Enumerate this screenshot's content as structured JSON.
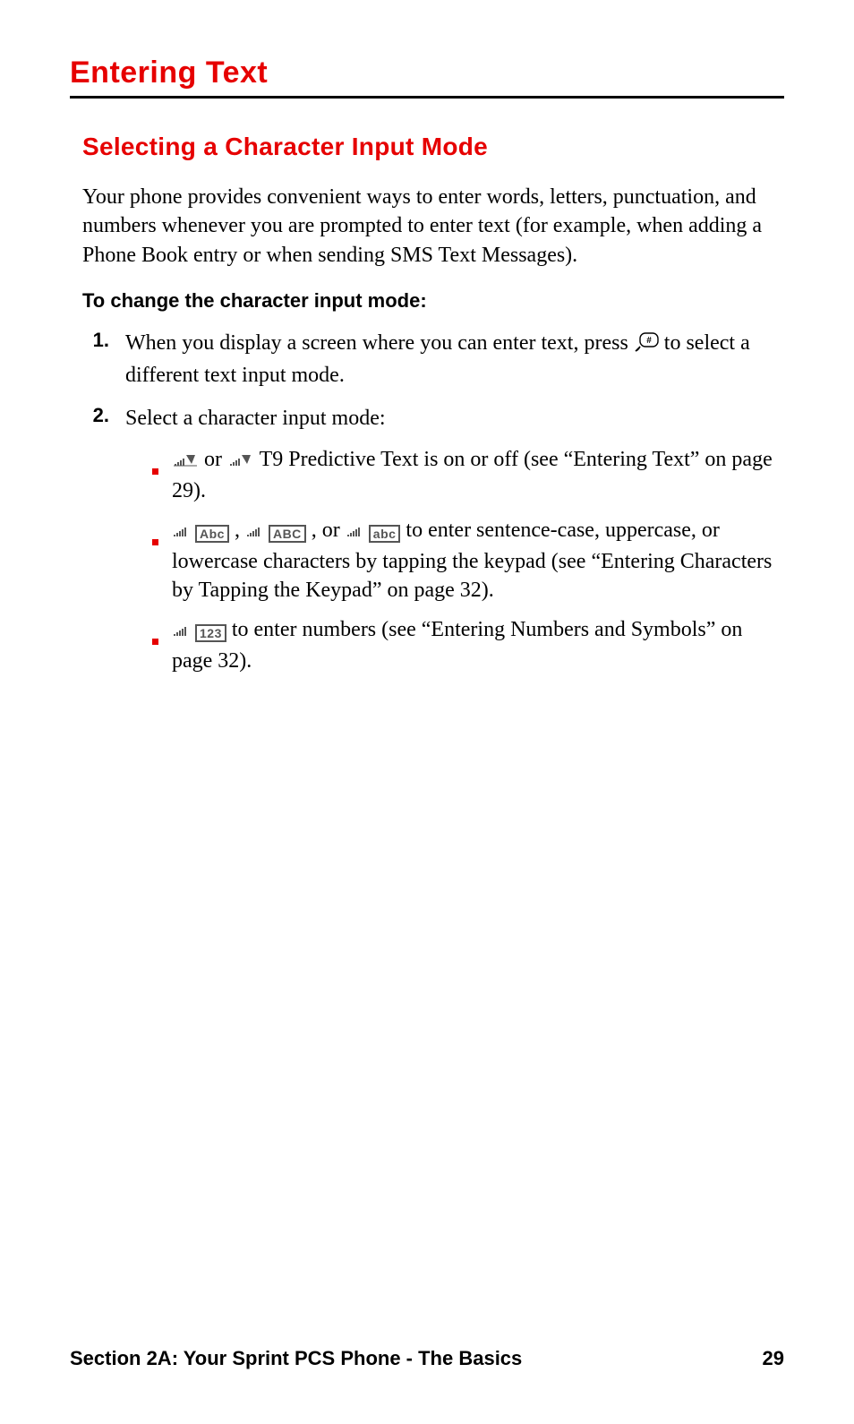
{
  "heading": "Entering Text",
  "subheading": "Selecting a Character Input Mode",
  "intro": "Your phone provides convenient ways to enter words, letters, punctuation, and numbers whenever you are prompted to enter text (for example, when adding a Phone Book entry or when sending SMS Text Messages).",
  "instruction_label": "To change the character input mode:",
  "steps": {
    "s1": {
      "num": "1.",
      "before_icon": "When you display a screen where you can enter text, press ",
      "after_icon": " to select a different text input mode."
    },
    "s2": {
      "num": "2.",
      "text": "Select a character input mode:"
    }
  },
  "bullets": {
    "b1": {
      "or": " or ",
      "tail": " T9 Predictive Text is on or off (see “Entering Text” on page 29)."
    },
    "b2": {
      "comma": " , ",
      "comma_or": " , or ",
      "tail": " to enter sentence-case, uppercase, or lowercase characters by tapping the keypad (see “Entering Characters by Tapping the Keypad” on page 32)."
    },
    "b3": {
      "tail": " to enter numbers (see “Entering Numbers and Symbols” on page 32)."
    }
  },
  "mode_labels": {
    "abc_mixed": "Abc",
    "abc_upper": "ABC",
    "abc_lower": "abc",
    "num": "123"
  },
  "footer": {
    "section": "Section 2A: Your Sprint PCS Phone - The Basics",
    "page": "29"
  }
}
